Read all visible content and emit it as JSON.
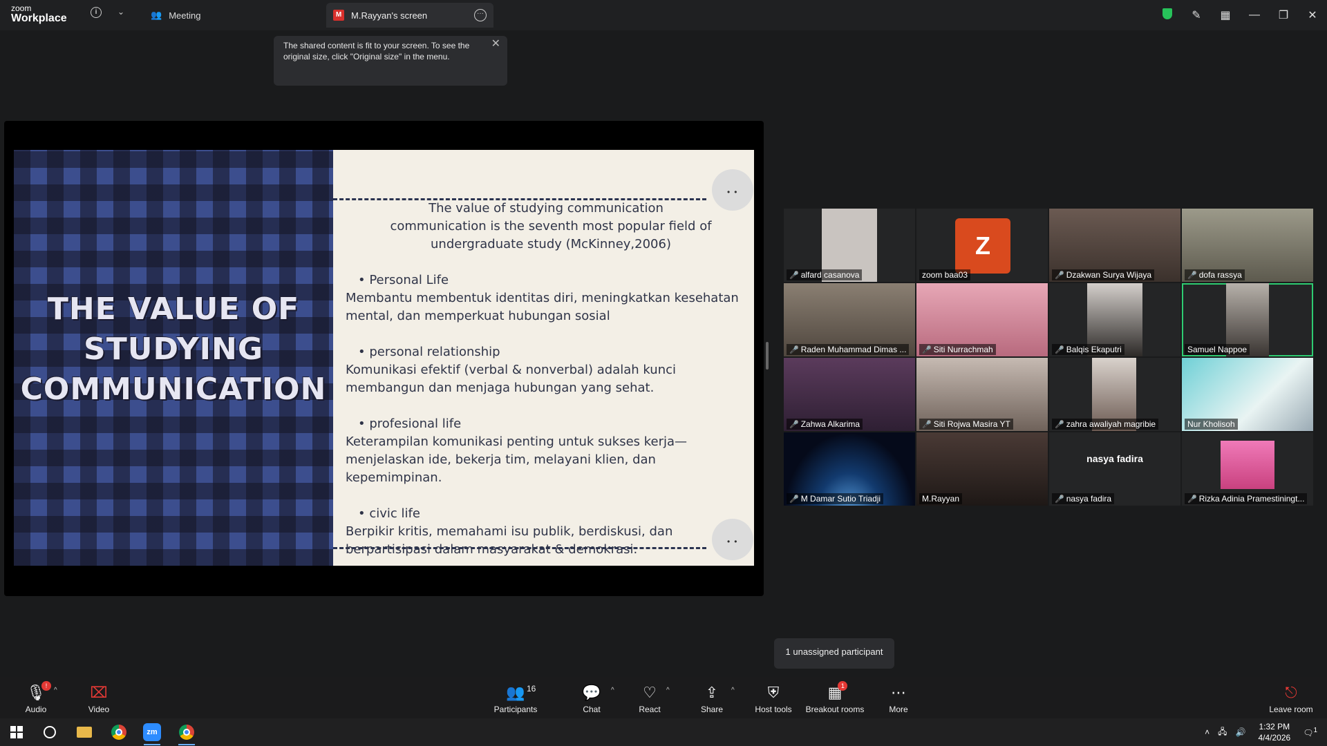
{
  "titlebar": {
    "logo_small": "zoom",
    "logo_big": "Workplace",
    "meeting_label": "Meeting",
    "tab_initial": "M",
    "tab_label": "M.Rayyan's screen"
  },
  "toast": {
    "text": "The shared content is fit to your screen. To see the original size, click \"Original size\" in the menu."
  },
  "slide": {
    "left_title_lines": [
      "THE VALUE OF",
      "STUDYING",
      "COMMUNICATION"
    ],
    "heading": "The value of studying communication",
    "subheading": "communication is the seventh most popular field of undergraduate study (McKinney,2006)",
    "sections": [
      {
        "bullet": "Personal Life",
        "text": "Membantu membentuk identitas diri, meningkatkan kesehatan mental, dan memperkuat hubungan sosial"
      },
      {
        "bullet": "personal relationship",
        "text": "Komunikasi efektif (verbal & nonverbal) adalah kunci membangun dan menjaga hubungan yang sehat."
      },
      {
        "bullet": " profesional life",
        "text": "Keterampilan komunikasi penting untuk sukses kerja—menjelaskan ide, bekerja tim, melayani klien, dan kepemimpinan."
      },
      {
        "bullet": "civic life",
        "text": "Berpikir kritis, memahami isu publik, berdiskusi, dan berpartisipasi dalam masyarakat & demokrasi."
      }
    ]
  },
  "participants": [
    {
      "name": "alfard casanova",
      "muted": true
    },
    {
      "name": "zoom baa03",
      "muted": false,
      "avatar": "Z"
    },
    {
      "name": "Dzakwan Surya Wijaya",
      "muted": true
    },
    {
      "name": "dofa rassya",
      "muted": true
    },
    {
      "name": "Raden Muhammad Dimas ...",
      "muted": true
    },
    {
      "name": "Siti Nurrachmah",
      "muted": true
    },
    {
      "name": "Balqis Ekaputri",
      "muted": true
    },
    {
      "name": "Samuel Nappoe",
      "muted": false
    },
    {
      "name": "Zahwa Alkarima",
      "muted": true
    },
    {
      "name": "Siti Rojwa Masira YT",
      "muted": true
    },
    {
      "name": "zahra awaliyah magribie",
      "muted": true
    },
    {
      "name": "Nur Kholisoh",
      "muted": false
    },
    {
      "name": "M Damar Sutio Triadji",
      "muted": true
    },
    {
      "name": "M.Rayyan",
      "muted": false
    },
    {
      "name": "nasya fadira",
      "muted": true,
      "center_name": "nasya fadira"
    },
    {
      "name": "Rizka Adinia Pramestiningt...",
      "muted": true
    }
  ],
  "tooltip": "1 unassigned participant",
  "controls": {
    "audio": "Audio",
    "video": "Video",
    "participants": "Participants",
    "participants_count": "16",
    "chat": "Chat",
    "react": "React",
    "share": "Share",
    "host_tools": "Host tools",
    "breakout": "Breakout rooms",
    "breakout_badge": "1",
    "audio_badge": "!",
    "more": "More",
    "leave": "Leave room"
  },
  "taskbar": {
    "time": "1:32 PM",
    "date": "4/4/2026",
    "zoom_app": "zm",
    "notif_count": "1"
  },
  "colors": {
    "accent_active": "#2ecc71",
    "muted_red": "#e53935",
    "zoom_blue": "#2d8cff"
  }
}
